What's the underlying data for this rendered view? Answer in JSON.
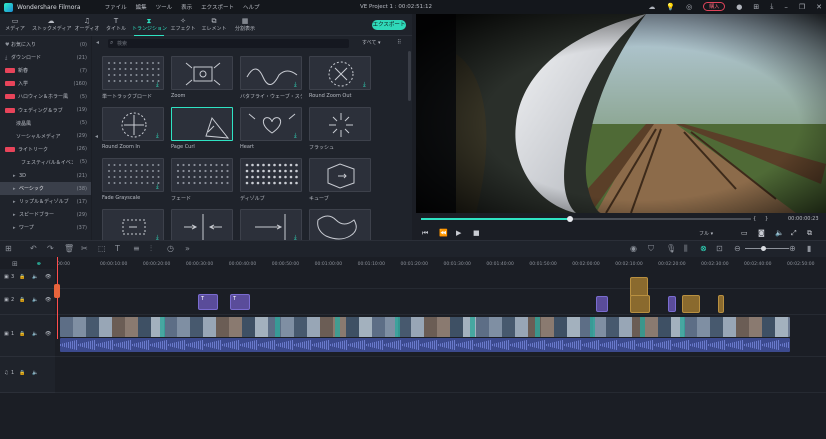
{
  "app": {
    "name": "Wondershare Filmora",
    "project_title": "VE Project 1 : 00:02:51:12"
  },
  "menu": [
    "ファイル",
    "編集",
    "ツール",
    "表示",
    "エクスポート",
    "ヘルプ"
  ],
  "titlebar_right": {
    "buy_label": "購入"
  },
  "tabs": [
    {
      "label": "メディア",
      "icon": "folder-icon"
    },
    {
      "label": "ストックメディア",
      "icon": "cloud-icon"
    },
    {
      "label": "オーディオ",
      "icon": "music-icon"
    },
    {
      "label": "タイトル",
      "icon": "text-icon"
    },
    {
      "label": "トランジション",
      "icon": "transition-icon"
    },
    {
      "label": "エフェクト",
      "icon": "effects-icon"
    },
    {
      "label": "エレメント",
      "icon": "elements-icon"
    },
    {
      "label": "分割表示",
      "icon": "split-icon"
    }
  ],
  "active_tab": "トランジション",
  "export_label": "エクスポート",
  "search": {
    "placeholder": "検索"
  },
  "filter_label": "すべて",
  "sidebar": [
    {
      "label": "お気に入り",
      "count": "(0)",
      "icon": "heart-icon"
    },
    {
      "label": "ダウンロード",
      "count": "(21)",
      "icon": "download-icon"
    },
    {
      "label": "新春",
      "count": "(7)",
      "hot": true
    },
    {
      "label": "入学",
      "count": "(160)",
      "hot": true
    },
    {
      "label": "ハロウィン＆ホラー風",
      "count": "(5)",
      "hot": true
    },
    {
      "label": "ウェディング＆ラブ",
      "count": "(19)",
      "hot": true,
      "expand": true
    },
    {
      "label": "液晶風",
      "count": "(5)",
      "indent": true
    },
    {
      "label": "ソーシャルメディア",
      "count": "(29)",
      "indent": true
    },
    {
      "label": "ライトリーク",
      "count": "(26)",
      "hot": true
    },
    {
      "label": "フェスティバル＆イベント",
      "count": "(5)"
    },
    {
      "label": "3D",
      "count": "(21)",
      "expand": true
    },
    {
      "label": "ベーシック",
      "count": "(38)",
      "expand": true,
      "selected": true
    },
    {
      "label": "リップル＆ディゾルブ",
      "count": "(17)",
      "expand": true
    },
    {
      "label": "スピードブラー",
      "count": "(29)",
      "expand": true
    },
    {
      "label": "ワープ",
      "count": "(37)",
      "expand": true
    }
  ],
  "transitions": [
    {
      "label": "単ートラックブロード",
      "download": true
    },
    {
      "label": "Zoom",
      "download": false
    },
    {
      "label": "バタフライ・ウェーブ・スクルーラー",
      "download": true
    },
    {
      "label": "Round Zoom Out",
      "download": true
    },
    {
      "label": "Round Zoom In",
      "download": true
    },
    {
      "label": "Page Curl",
      "download": false,
      "selected": true
    },
    {
      "label": "Heart",
      "download": true
    },
    {
      "label": "フラッシュ",
      "download": false
    },
    {
      "label": "Fade Grayscale",
      "download": true
    },
    {
      "label": "フェード",
      "download": false
    },
    {
      "label": "ディゾルブ",
      "download": false
    },
    {
      "label": "キューブ",
      "download": false
    },
    {
      "label": "",
      "download": true
    },
    {
      "label": "",
      "download": false
    },
    {
      "label": "",
      "download": true
    },
    {
      "label": "",
      "download": false
    }
  ],
  "preview": {
    "timecode_right": "00:00:00:23",
    "bracket_left": "{",
    "bracket_right": "}",
    "progress": 0.45,
    "quality": "フル"
  },
  "ruler_ticks": [
    "00:00",
    "00:00:10:00",
    "00:00:20:00",
    "00:00:30:00",
    "00:00:40:00",
    "00:00:50:00",
    "00:01:00:00",
    "00:01:10:00",
    "00:01:20:00",
    "00:01:30:00",
    "00:01:40:00",
    "00:01:50:00",
    "00:02:00:00",
    "00:02:10:00",
    "00:02:20:00",
    "00:02:30:00",
    "00:02:40:00",
    "00:02:50:00"
  ],
  "tracks": [
    {
      "id": "3",
      "type": "video"
    },
    {
      "id": "2",
      "type": "video"
    },
    {
      "id": "1",
      "type": "video"
    },
    {
      "id": "1",
      "type": "audio"
    }
  ],
  "colors": {
    "accent": "#2fe3c3",
    "hot": "#e8445a",
    "title_clip": "#5a4c9a",
    "audio_clip": "#3c4a8e",
    "playhead": "#ff4d4d"
  }
}
